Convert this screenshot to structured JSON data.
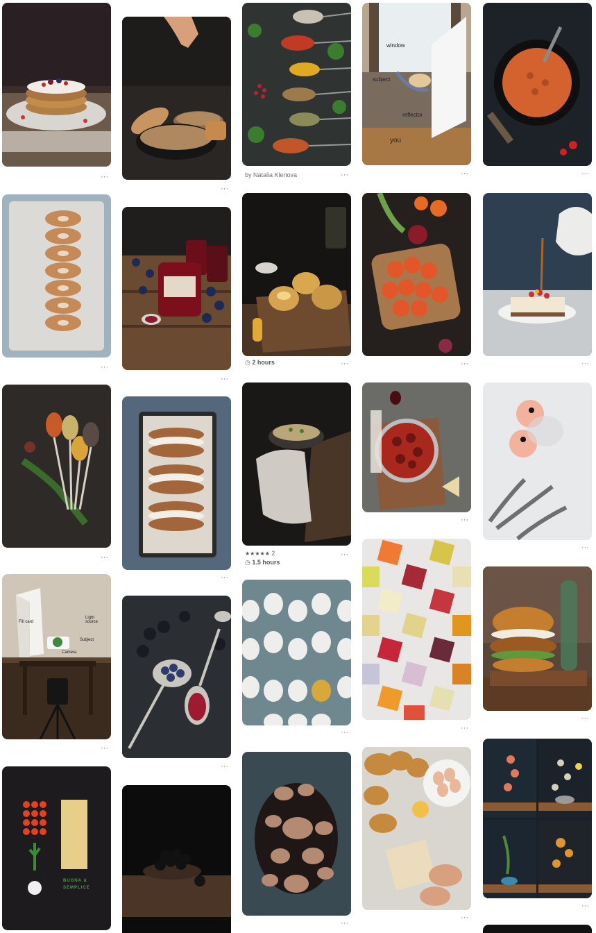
{
  "board": {
    "pins": [
      {
        "id": "p1",
        "alt": "pancake stack"
      },
      {
        "id": "p2"
      },
      {
        "id": "p3",
        "caption": "by Natalia Klenova"
      },
      {
        "id": "p4",
        "labels": {
          "window": "window",
          "subject": "subject",
          "reflector": "reflector",
          "you": "you"
        }
      },
      {
        "id": "p5"
      },
      {
        "id": "p6"
      },
      {
        "id": "p7"
      },
      {
        "id": "p8",
        "time": "2 hours"
      },
      {
        "id": "p9"
      },
      {
        "id": "p10"
      },
      {
        "id": "p11"
      },
      {
        "id": "p12"
      },
      {
        "id": "p13",
        "rating_stars": "★★★★★",
        "rating_count": "2",
        "time": "1.5 hours"
      },
      {
        "id": "p14"
      },
      {
        "id": "p15"
      },
      {
        "id": "p16",
        "labels": {
          "fill": "Fill card",
          "light": "Light source",
          "subject": "Subject",
          "camera": "Camera"
        }
      },
      {
        "id": "p17"
      },
      {
        "id": "p18"
      },
      {
        "id": "p19"
      },
      {
        "id": "p20"
      },
      {
        "id": "p21",
        "text": "BUONA & SEMPLICE"
      },
      {
        "id": "p22"
      },
      {
        "id": "p23"
      },
      {
        "id": "p24"
      },
      {
        "id": "p25"
      }
    ],
    "more_label": "···",
    "clock_icon": "clock-icon",
    "colors": {
      "bg": "#ffffff",
      "meta": "#6e6e6e",
      "dark_photo": "#1a1a1a"
    }
  }
}
